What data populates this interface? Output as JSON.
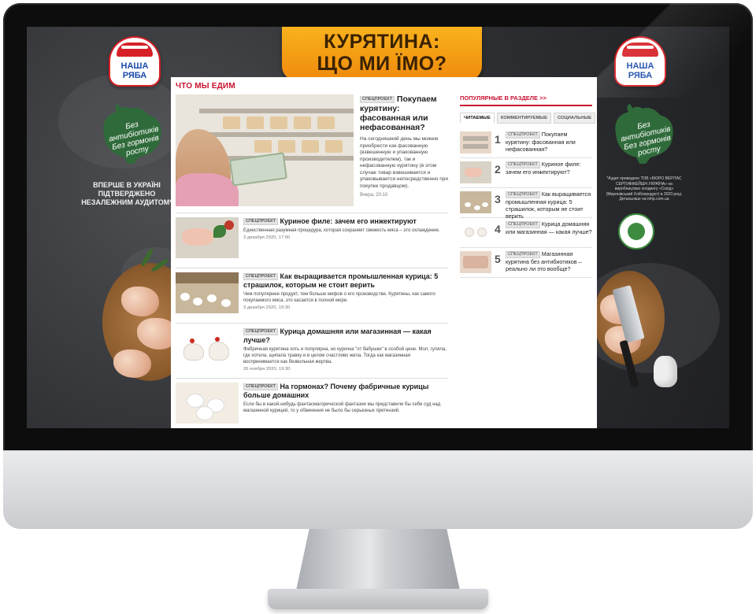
{
  "banner": {
    "line1": "КУРЯТИНА:",
    "line2": "ЩО МИ ЇМО?"
  },
  "brand": {
    "line1": "НАША",
    "line2": "РЯБА"
  },
  "badge": {
    "line1": "Без антибіотиків",
    "line2": "Без гормонів росту"
  },
  "left_claim": "ВПЕРШЕ В УКРАЇНІ ПІДТВЕРДЖЕНО НЕЗАЛЕЖНИМ АУДИТОМ*",
  "right_note": "*Аудит проведено ТОВ «БЮРО ВЕРІТАС СЕРТИФІКЕЙШН УКРАЇНА» на виробництвах холдингу «Сохід» (Миронівський Хлібопродукт) в 2020 році. Детальніше на mhp.com.ua",
  "section_title": "ЧТО МЫ ЕДИМ",
  "tag_label": "СПЕЦПРОЕКТ",
  "lead": {
    "title": "Покупаем курятину: фасованная или нефасованная?",
    "desc": "На сегодняшний день мы можем приобрести как фасованную (взвешенную и упакованную производителем), так и нефасованную курятину (в этом случае товар взвешивается и упаковывается непосредственно при покупке продавцом).",
    "time": "Вчера, 20:10"
  },
  "articles": [
    {
      "title": "Куриное филе: зачем его инжектируют",
      "desc": "Единственная разумная процедура, которая сохраняет свежесть мяса – это охлаждение.",
      "date": "3 декабря 2020, 17:00"
    },
    {
      "title": "Как выращивается промышленная курица: 5 страшилок, которым не стоит верить",
      "desc": "Чем популярнее продукт, тем больше мифов о его производстве. Курятины, как самого покупаемого мяса, это касается в полной мере.",
      "date": "3 декабря 2020, 19:30"
    },
    {
      "title": "Курица домашняя или магазинная — какая лучше?",
      "desc": "Фабричная курятина хоть и популярна, но курочка \"от бабушки\" в особой цене. Мол, гуляла, где хотела, щипала травку и в целом счастливо жила. Тогда как магазинная воспринимается как безвольная жертва.",
      "date": "26 ноября 2020, 19:30"
    },
    {
      "title": "На гормонах? Почему фабричные курицы больше домашних",
      "desc": "Если бы в какой-нибудь фантасмагорической фантазии мы представили бы себе суд над магазинной курицей, то у обвинения не было бы серьезных претензий.",
      "date": ""
    }
  ],
  "popular": {
    "title": "ПОПУЛЯРНЫЕ В РАЗДЕЛЕ >>",
    "tabs": [
      "ЧИТАЕМЫЕ",
      "КОММЕНТИРУЕМЫЕ",
      "СОЦИАЛЬНЫЕ"
    ],
    "items": [
      {
        "num": "1",
        "title": "Покупаем курятину: фасованная или нефасованная?"
      },
      {
        "num": "2",
        "title": "Куриное филе: зачем его инжектируют?"
      },
      {
        "num": "3",
        "title": "Как выращивается промышленная курица: 5 страшилок, которым не стоит верить"
      },
      {
        "num": "4",
        "title": "Курица домашняя или магазинная — какая лучше?"
      },
      {
        "num": "5",
        "title": "Магазинная курятина без антибиотиков – реально ли это вообще?"
      }
    ]
  },
  "colors": {
    "accent": "#c8102e",
    "banner": "#f5a11a",
    "brand_blue": "#1a4aa8",
    "badge_green": "#2f6b3a"
  }
}
